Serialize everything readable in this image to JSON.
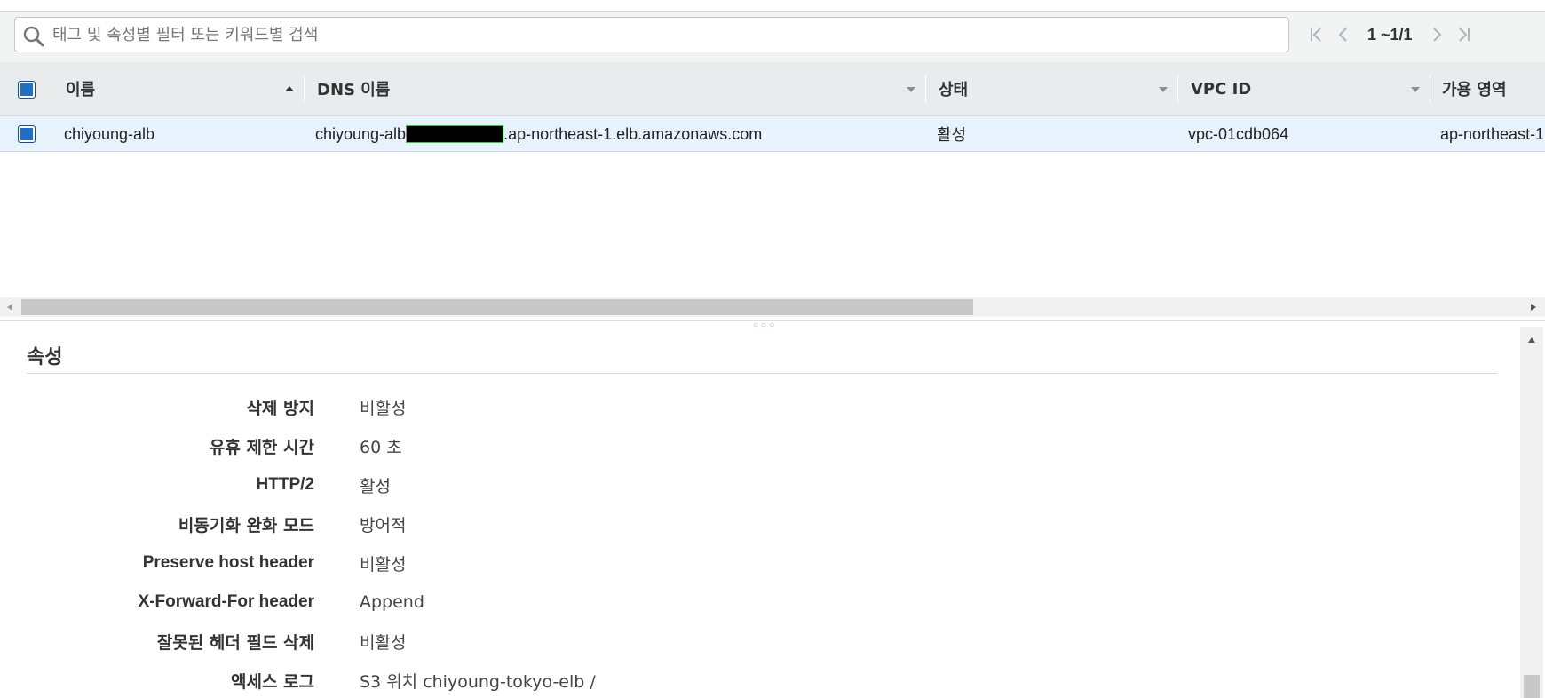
{
  "search": {
    "placeholder": "태그 및 속성별 필터 또는 키워드별 검색"
  },
  "pager": {
    "range": "1 ~1/1"
  },
  "table": {
    "columns": [
      "이름",
      "DNS 이름",
      "상태",
      "VPC ID",
      "가용 영역"
    ],
    "row": {
      "name": "chiyoung-alb",
      "dns_prefix": "chiyoung-alb",
      "dns_suffix": ".ap-northeast-1.elb.amazonaws.com",
      "state": "활성",
      "vpc_id": "vpc-01cdb064",
      "az": "ap-northeast-1"
    }
  },
  "attributes": {
    "title": "속성",
    "items": [
      {
        "label": "삭제 방지",
        "value": "비활성"
      },
      {
        "label": "유휴 제한 시간",
        "value": "60 초"
      },
      {
        "label": "HTTP/2",
        "value": "활성"
      },
      {
        "label": "비동기화 완화 모드",
        "value": "방어적"
      },
      {
        "label": "Preserve host header",
        "value": "비활성"
      },
      {
        "label": "X-Forward-For header",
        "value": "Append"
      },
      {
        "label": "잘못된 헤더 필드 삭제",
        "value": "비활성"
      },
      {
        "label": "액세스 로그",
        "value": "S3 위치 chiyoung-tokyo-elb /"
      }
    ]
  },
  "colors": {
    "accent": "#1f6fc6",
    "selected_row": "#e8f2fc",
    "header_bg": "#e9ebed"
  }
}
